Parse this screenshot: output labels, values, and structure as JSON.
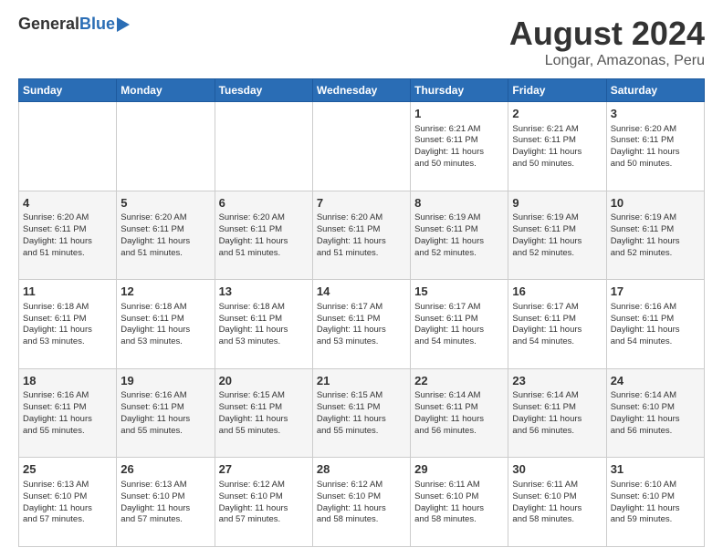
{
  "header": {
    "logo_general": "General",
    "logo_blue": "Blue",
    "main_title": "August 2024",
    "subtitle": "Longar, Amazonas, Peru"
  },
  "days_of_week": [
    "Sunday",
    "Monday",
    "Tuesday",
    "Wednesday",
    "Thursday",
    "Friday",
    "Saturday"
  ],
  "weeks": [
    [
      {
        "day": "",
        "info": ""
      },
      {
        "day": "",
        "info": ""
      },
      {
        "day": "",
        "info": ""
      },
      {
        "day": "",
        "info": ""
      },
      {
        "day": "1",
        "info": "Sunrise: 6:21 AM\nSunset: 6:11 PM\nDaylight: 11 hours\nand 50 minutes."
      },
      {
        "day": "2",
        "info": "Sunrise: 6:21 AM\nSunset: 6:11 PM\nDaylight: 11 hours\nand 50 minutes."
      },
      {
        "day": "3",
        "info": "Sunrise: 6:20 AM\nSunset: 6:11 PM\nDaylight: 11 hours\nand 50 minutes."
      }
    ],
    [
      {
        "day": "4",
        "info": "Sunrise: 6:20 AM\nSunset: 6:11 PM\nDaylight: 11 hours\nand 51 minutes."
      },
      {
        "day": "5",
        "info": "Sunrise: 6:20 AM\nSunset: 6:11 PM\nDaylight: 11 hours\nand 51 minutes."
      },
      {
        "day": "6",
        "info": "Sunrise: 6:20 AM\nSunset: 6:11 PM\nDaylight: 11 hours\nand 51 minutes."
      },
      {
        "day": "7",
        "info": "Sunrise: 6:20 AM\nSunset: 6:11 PM\nDaylight: 11 hours\nand 51 minutes."
      },
      {
        "day": "8",
        "info": "Sunrise: 6:19 AM\nSunset: 6:11 PM\nDaylight: 11 hours\nand 52 minutes."
      },
      {
        "day": "9",
        "info": "Sunrise: 6:19 AM\nSunset: 6:11 PM\nDaylight: 11 hours\nand 52 minutes."
      },
      {
        "day": "10",
        "info": "Sunrise: 6:19 AM\nSunset: 6:11 PM\nDaylight: 11 hours\nand 52 minutes."
      }
    ],
    [
      {
        "day": "11",
        "info": "Sunrise: 6:18 AM\nSunset: 6:11 PM\nDaylight: 11 hours\nand 53 minutes."
      },
      {
        "day": "12",
        "info": "Sunrise: 6:18 AM\nSunset: 6:11 PM\nDaylight: 11 hours\nand 53 minutes."
      },
      {
        "day": "13",
        "info": "Sunrise: 6:18 AM\nSunset: 6:11 PM\nDaylight: 11 hours\nand 53 minutes."
      },
      {
        "day": "14",
        "info": "Sunrise: 6:17 AM\nSunset: 6:11 PM\nDaylight: 11 hours\nand 53 minutes."
      },
      {
        "day": "15",
        "info": "Sunrise: 6:17 AM\nSunset: 6:11 PM\nDaylight: 11 hours\nand 54 minutes."
      },
      {
        "day": "16",
        "info": "Sunrise: 6:17 AM\nSunset: 6:11 PM\nDaylight: 11 hours\nand 54 minutes."
      },
      {
        "day": "17",
        "info": "Sunrise: 6:16 AM\nSunset: 6:11 PM\nDaylight: 11 hours\nand 54 minutes."
      }
    ],
    [
      {
        "day": "18",
        "info": "Sunrise: 6:16 AM\nSunset: 6:11 PM\nDaylight: 11 hours\nand 55 minutes."
      },
      {
        "day": "19",
        "info": "Sunrise: 6:16 AM\nSunset: 6:11 PM\nDaylight: 11 hours\nand 55 minutes."
      },
      {
        "day": "20",
        "info": "Sunrise: 6:15 AM\nSunset: 6:11 PM\nDaylight: 11 hours\nand 55 minutes."
      },
      {
        "day": "21",
        "info": "Sunrise: 6:15 AM\nSunset: 6:11 PM\nDaylight: 11 hours\nand 55 minutes."
      },
      {
        "day": "22",
        "info": "Sunrise: 6:14 AM\nSunset: 6:11 PM\nDaylight: 11 hours\nand 56 minutes."
      },
      {
        "day": "23",
        "info": "Sunrise: 6:14 AM\nSunset: 6:11 PM\nDaylight: 11 hours\nand 56 minutes."
      },
      {
        "day": "24",
        "info": "Sunrise: 6:14 AM\nSunset: 6:10 PM\nDaylight: 11 hours\nand 56 minutes."
      }
    ],
    [
      {
        "day": "25",
        "info": "Sunrise: 6:13 AM\nSunset: 6:10 PM\nDaylight: 11 hours\nand 57 minutes."
      },
      {
        "day": "26",
        "info": "Sunrise: 6:13 AM\nSunset: 6:10 PM\nDaylight: 11 hours\nand 57 minutes."
      },
      {
        "day": "27",
        "info": "Sunrise: 6:12 AM\nSunset: 6:10 PM\nDaylight: 11 hours\nand 57 minutes."
      },
      {
        "day": "28",
        "info": "Sunrise: 6:12 AM\nSunset: 6:10 PM\nDaylight: 11 hours\nand 58 minutes."
      },
      {
        "day": "29",
        "info": "Sunrise: 6:11 AM\nSunset: 6:10 PM\nDaylight: 11 hours\nand 58 minutes."
      },
      {
        "day": "30",
        "info": "Sunrise: 6:11 AM\nSunset: 6:10 PM\nDaylight: 11 hours\nand 58 minutes."
      },
      {
        "day": "31",
        "info": "Sunrise: 6:10 AM\nSunset: 6:10 PM\nDaylight: 11 hours\nand 59 minutes."
      }
    ]
  ]
}
